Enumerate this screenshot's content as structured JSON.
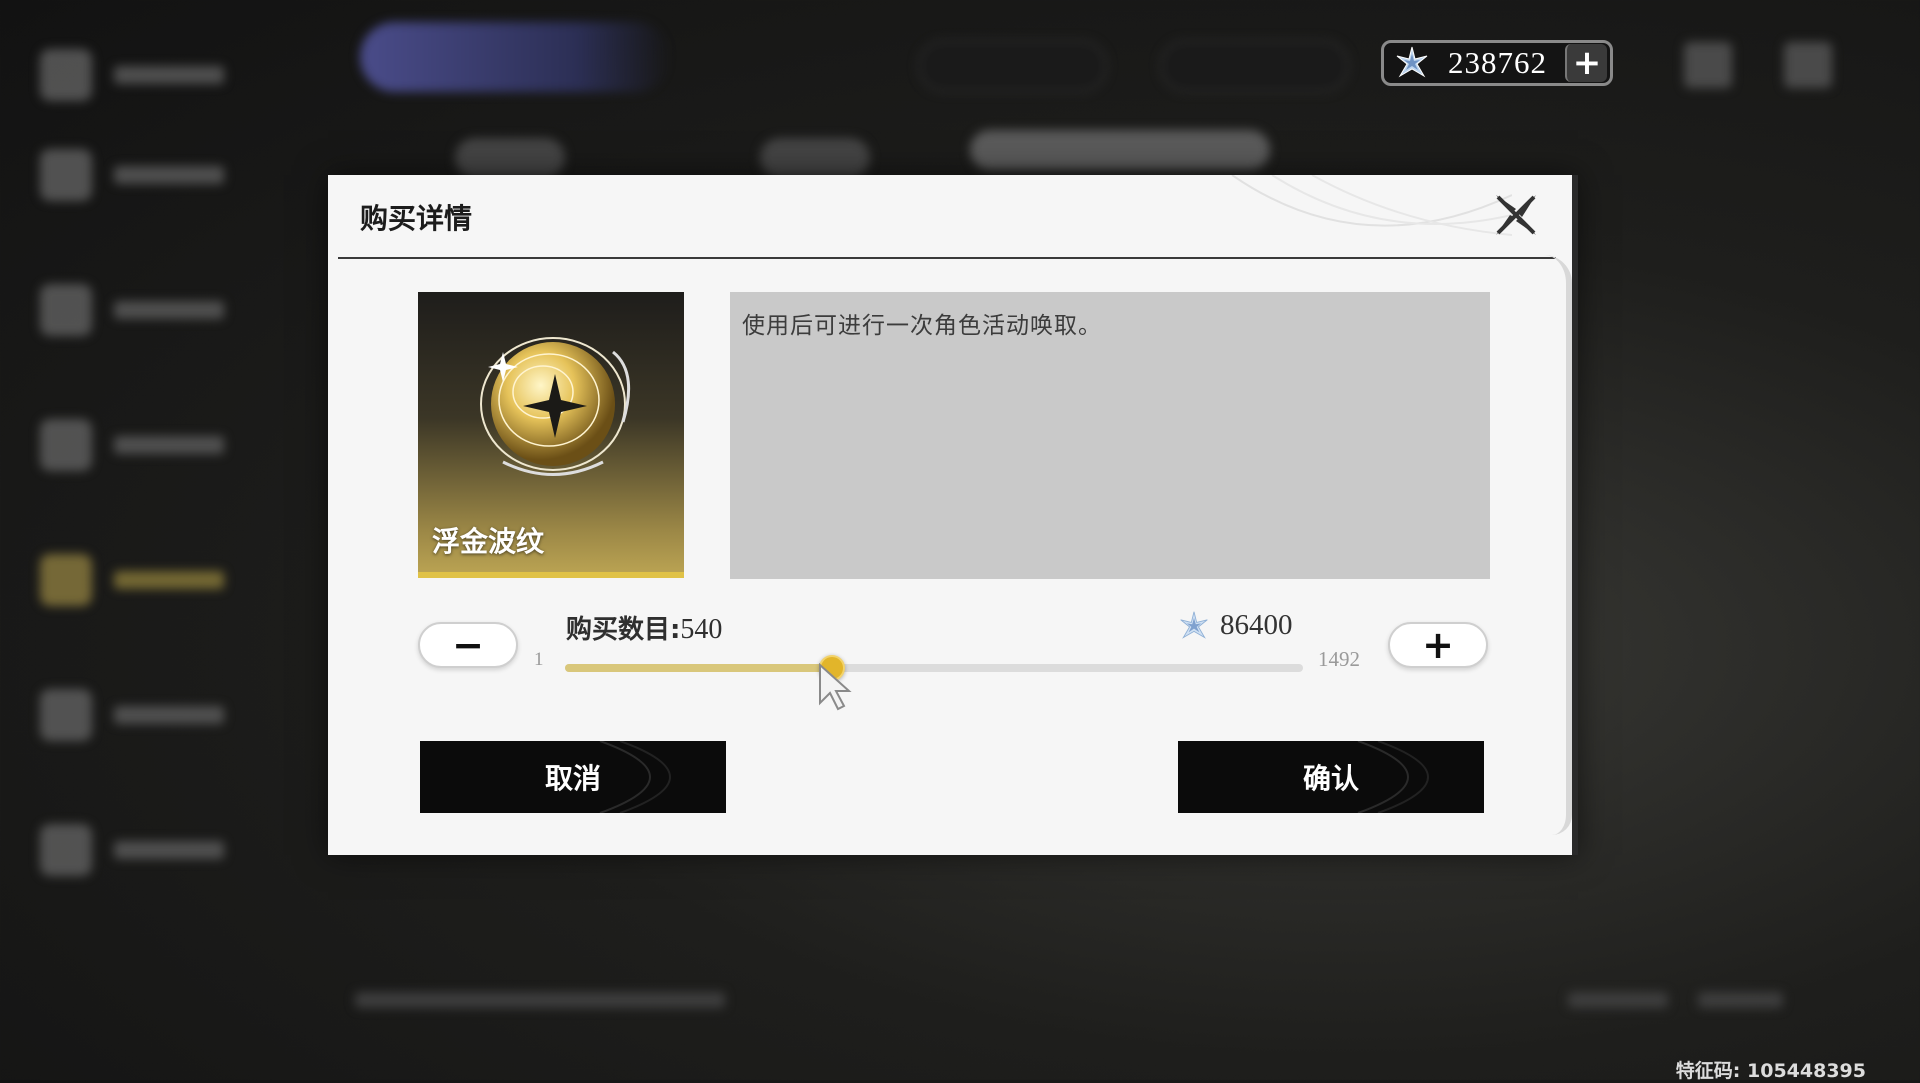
{
  "currency": {
    "amount": "238762",
    "plus_label": "+",
    "icon": "star-crystal-icon"
  },
  "dialog": {
    "title": "购买详情",
    "item": {
      "name": "浮金波纹",
      "icon": "golden-ripple-orb"
    },
    "description": "使用后可进行一次角色活动唤取。",
    "quantity": {
      "label": "购买数目:",
      "value": "540",
      "min": "1",
      "max": "1492",
      "minus_label": "−",
      "plus_label": "+"
    },
    "cost": {
      "value": "86400",
      "icon": "star-crystal-icon"
    },
    "buttons": {
      "cancel": "取消",
      "confirm": "确认"
    }
  },
  "footer": {
    "feature_code": "特征码: 105448395"
  },
  "colors": {
    "accent_gold": "#e2b52a",
    "slider_fill": "#d9c77b",
    "button_dark": "#0b0b0b"
  }
}
